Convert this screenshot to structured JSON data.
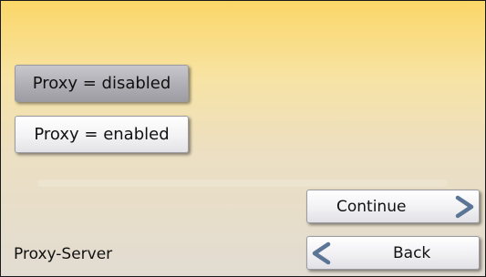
{
  "options": {
    "proxy_disabled": "Proxy = disabled",
    "proxy_enabled": "Proxy = enabled",
    "selected": "proxy_disabled"
  },
  "nav": {
    "continue_label": "Continue",
    "back_label": "Back"
  },
  "footer": {
    "title": "Proxy-Server"
  },
  "colors": {
    "background_top": "#fbd768",
    "background_bottom": "#e2dcd2",
    "chevron": "#5b7596",
    "selected_button": "#acacb2"
  },
  "icons": {
    "continue": "chevron-right-icon",
    "back": "chevron-left-icon"
  }
}
